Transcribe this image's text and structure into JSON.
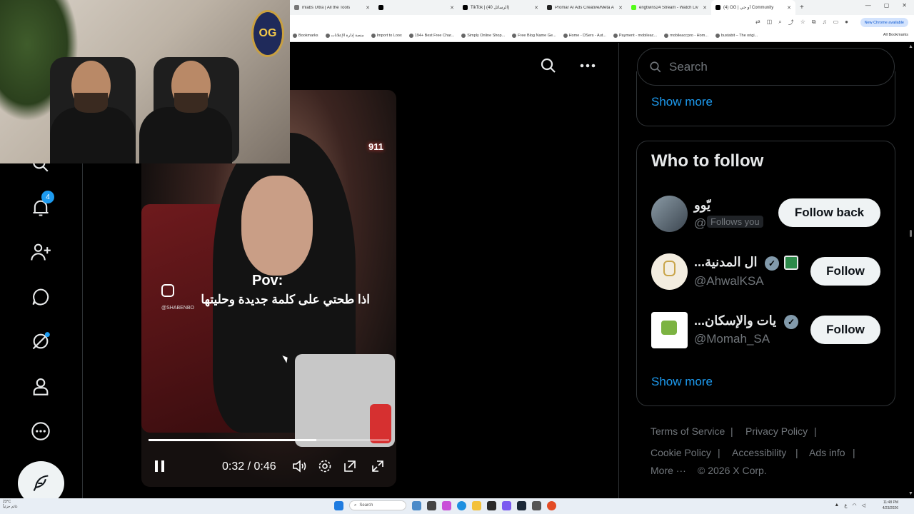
{
  "browser": {
    "tabs": [
      {
        "title": "mlabs Ultra | All the Tools",
        "favicon_color": "#777777"
      },
      {
        "title": "",
        "favicon_color": "#000000"
      },
      {
        "title": "TikTok | (الرسائل 40)",
        "favicon_color": "#000000"
      },
      {
        "title": "Promar AI Ads Creative/Meta A",
        "favicon_color": "#222222"
      },
      {
        "title": "engtwins24 Stream - Watch Liv",
        "favicon_color": "#53fc18"
      },
      {
        "title": "(4) OG | أو جي Community",
        "favicon_color": "#000000",
        "active": true
      }
    ],
    "new_chrome_label": "New Chrome available",
    "bookmarks": [
      "Bookmarks",
      "منصة إدارة الإعلانات",
      "Import to Loox",
      "194+ Best Free Char...",
      "Simply Online Shop...",
      "Free Blog Name Ge...",
      "Home - DSers - Aut...",
      "Payment - mobileac...",
      "mobileaccpro - Hom...",
      "bustabit – The origi..."
    ],
    "all_bookmarks_label": "All Bookmarks"
  },
  "webcam": {
    "badge_text": "OG"
  },
  "nav": {
    "notification_count": "4"
  },
  "video": {
    "pov_label": "Pov:",
    "caption": "اذا طحتي على كلمة جديدة وحليتها",
    "watermark_handle": "@SHABENBO",
    "sign_text": "911",
    "current_time": "0:32",
    "duration": "0:46",
    "time_display": "0:32 / 0:46",
    "progress": 0.696
  },
  "sidebar": {
    "search_placeholder": "Search",
    "show_more_top": "Show more",
    "who_to_follow_title": "Who to follow",
    "accounts": [
      {
        "name": "يّوو",
        "handle": "@",
        "follows_you": "Follows you",
        "button": "Follow back",
        "verified": false
      },
      {
        "name": "...ال المدنية",
        "handle": "@AhwalKSA",
        "button": "Follow",
        "verified": true
      },
      {
        "name": "...يات والإسكان",
        "handle": "@Momah_SA",
        "button": "Follow",
        "verified": true
      }
    ],
    "show_more_bottom": "Show more",
    "footer": {
      "terms": "Terms of Service",
      "privacy": "Privacy Policy",
      "cookie": "Cookie Policy",
      "accessibility": "Accessibility",
      "ads_info": "Ads info",
      "more": "More ···",
      "copyright": "© 2026 X Corp."
    }
  },
  "taskbar": {
    "weather_temp": "23°C",
    "weather_text": "غائم جزئياً",
    "search_label": "Search",
    "time": "11:48 PM",
    "date": "4/23/2026"
  }
}
